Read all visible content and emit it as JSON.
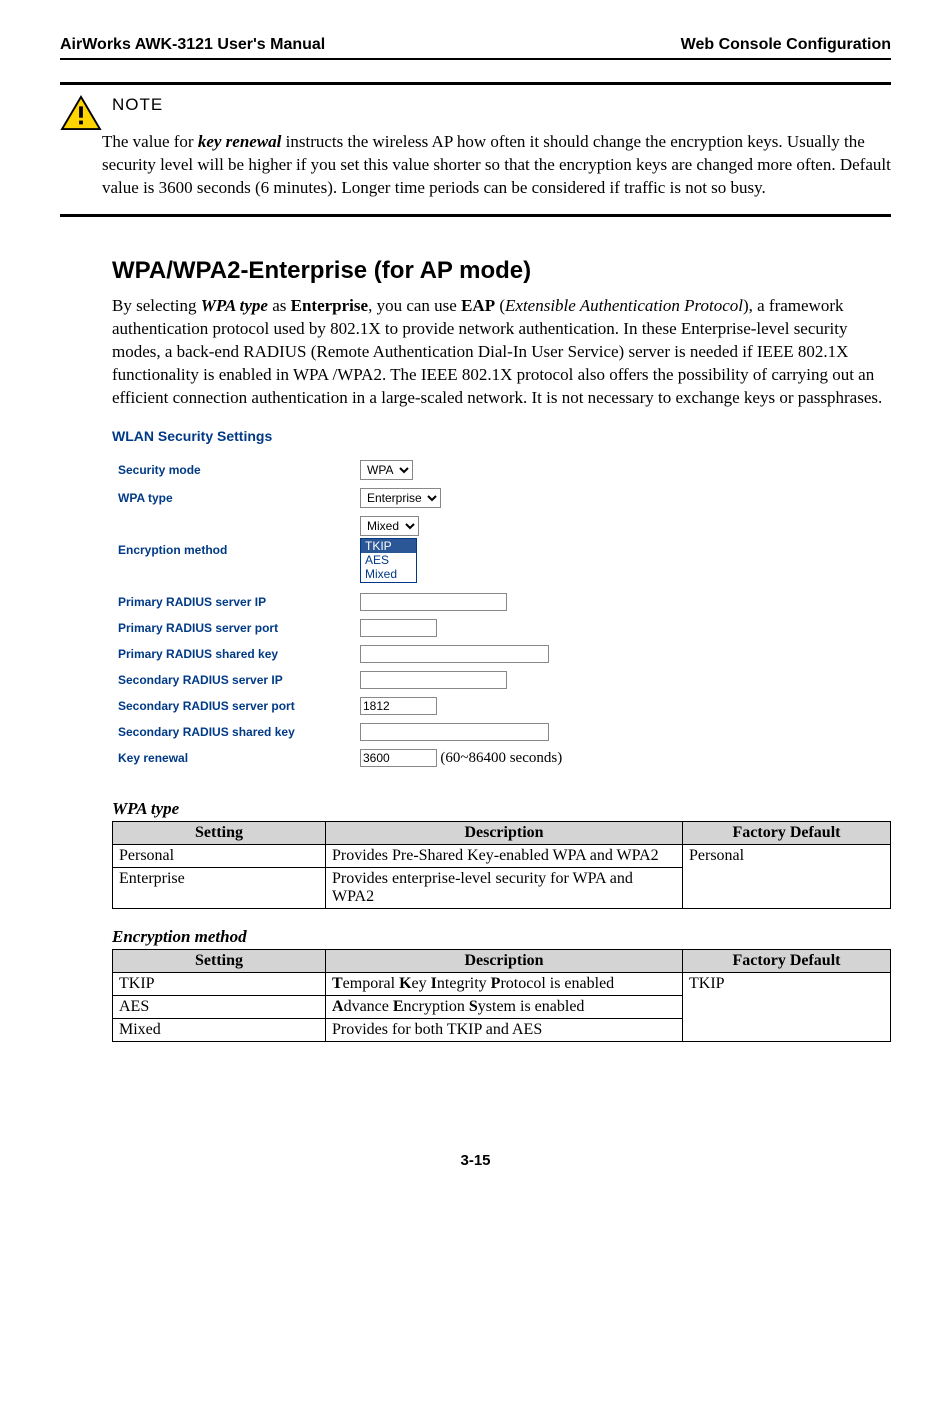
{
  "header": {
    "left": "AirWorks AWK-3121 User's Manual",
    "right": "Web Console Configuration"
  },
  "note": {
    "label": "NOTE",
    "pre": "The value for ",
    "term": "key renewal",
    "post": " instructs the wireless AP how often it should change the encryption keys. Usually the security level will be higher if you set this value shorter so that the encryption keys are changed more often. Default value is 3600 seconds (6 minutes). Longer time periods can be considered if traffic is not so busy."
  },
  "section_title": "WPA/WPA2-Enterprise (for AP mode)",
  "intro": {
    "t1": "By selecting ",
    "wpa_type": "WPA type",
    "t2": " as ",
    "enterprise": "Enterprise",
    "t3": ", you can use ",
    "eap": "EAP",
    "t4": " (",
    "eap_full": "Extensible Authentication Protocol",
    "t5": "), a framework authentication protocol used by 802.1X to provide network authentication. In these Enterprise-level security modes, a back-end RADIUS (Remote Authentication Dial-In User Service) server is needed if IEEE 802.1X functionality is enabled in WPA /WPA2. The IEEE 802.1X protocol also offers the possibility of carrying out an efficient connection authentication in a large-scaled network. It is not necessary to exchange keys or passphrases."
  },
  "screenshot": {
    "title": "WLAN Security Settings",
    "rows": {
      "security_mode": {
        "label": "Security mode",
        "value": "WPA"
      },
      "wpa_type": {
        "label": "WPA type",
        "value": "Enterprise"
      },
      "enc_method": {
        "label": "Encryption method",
        "value": "Mixed"
      },
      "enc_options": [
        "TKIP",
        "AES",
        "Mixed"
      ],
      "p_ip": {
        "label": "Primary RADIUS server IP",
        "value": ""
      },
      "p_port": {
        "label": "Primary RADIUS server port",
        "value": ""
      },
      "p_key": {
        "label": "Primary RADIUS shared key",
        "value": ""
      },
      "s_ip": {
        "label": "Secondary RADIUS server IP",
        "value": ""
      },
      "s_port": {
        "label": "Secondary RADIUS server port",
        "value": "1812"
      },
      "s_key": {
        "label": "Secondary RADIUS shared key",
        "value": ""
      },
      "key_renewal": {
        "label": "Key renewal",
        "value": "3600",
        "unit": "(60~86400 seconds)"
      }
    }
  },
  "table1": {
    "caption": "WPA type",
    "headers": [
      "Setting",
      "Description",
      "Factory Default"
    ],
    "rows": [
      {
        "s": "Personal",
        "d": "Provides Pre-Shared Key-enabled WPA and WPA2"
      },
      {
        "s": "Enterprise",
        "d": "Provides enterprise-level security for WPA and WPA2"
      }
    ],
    "default": "Personal"
  },
  "table2": {
    "caption": "Encryption method",
    "headers": [
      "Setting",
      "Description",
      "Factory Default"
    ],
    "rows": [
      {
        "s": "TKIP",
        "pre": "T",
        "mid": "emporal ",
        "k": "K",
        "mid2": "ey ",
        "i": "I",
        "mid3": "ntegrity ",
        "p": "P",
        "post": "rotocol is enabled"
      },
      {
        "s": "AES",
        "pre": "A",
        "mid": "dvance ",
        "k": "E",
        "mid2": "ncryption ",
        "i": "S",
        "post": "ystem is enabled"
      },
      {
        "s": "Mixed",
        "plain": "Provides for both TKIP and AES"
      }
    ],
    "default": "TKIP"
  },
  "footer": "3-15"
}
